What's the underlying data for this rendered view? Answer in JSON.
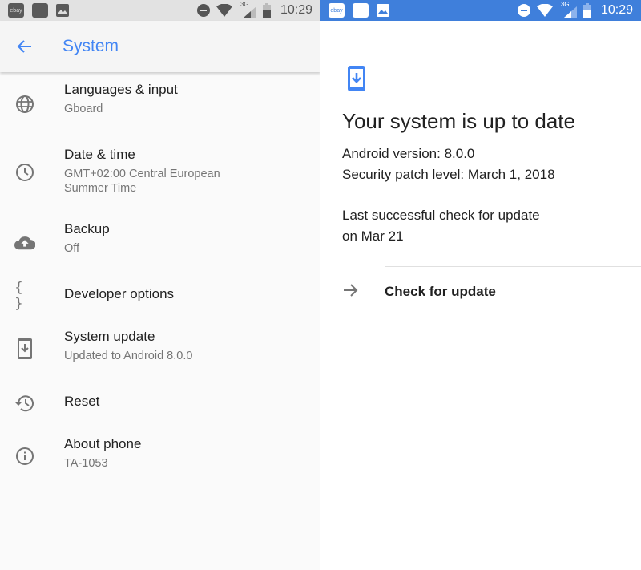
{
  "left_screen": {
    "status_bar": {
      "notifications": [
        "ebay",
        "app",
        "image"
      ],
      "notification_labels": {
        "ebay": "ebay"
      },
      "icons": [
        "do-not-disturb-icon",
        "wifi-icon",
        "signal-3g-icon",
        "battery-icon"
      ],
      "network_label": "3G",
      "time": "10:29"
    },
    "toolbar": {
      "back_icon": "arrow-back-icon",
      "title": "System"
    },
    "items": [
      {
        "icon": "globe-icon",
        "title": "Languages & input",
        "summary": "Gboard"
      },
      {
        "icon": "clock-icon",
        "title": "Date & time",
        "summary": "GMT+02:00 Central European Summer Time"
      },
      {
        "icon": "cloud-upload-icon",
        "title": "Backup",
        "summary": "Off"
      },
      {
        "icon": "braces-icon",
        "title": "Developer options",
        "summary": ""
      },
      {
        "icon": "system-update-icon",
        "title": "System update",
        "summary": "Updated to Android 8.0.0"
      },
      {
        "icon": "restore-icon",
        "title": "Reset",
        "summary": ""
      },
      {
        "icon": "info-icon",
        "title": "About phone",
        "summary": "TA-1053"
      }
    ],
    "date_summary_line1": "GMT+02:00 Central European",
    "date_summary_line2": "Summer Time",
    "braces_glyph": "{ }"
  },
  "right_screen": {
    "status_bar": {
      "notification_labels": {
        "ebay": "ebay"
      },
      "network_label": "3G",
      "time": "10:29"
    },
    "update_icon": "system-update-icon",
    "headline": "Your system is up to date",
    "android_version": "Android version: 8.0.0",
    "security_patch": "Security patch level: March 1, 2018",
    "last_check_line1": "Last successful check for update",
    "last_check_line2": "on Mar 21",
    "check_button": {
      "icon": "arrow-forward-icon",
      "label": "Check for update"
    }
  },
  "colors": {
    "accent": "#4285f4",
    "status_bar_blue": "#3f7fdb",
    "status_bar_gray": "#e2e2e2",
    "primary_text": "#212121",
    "secondary_text": "#757575"
  }
}
